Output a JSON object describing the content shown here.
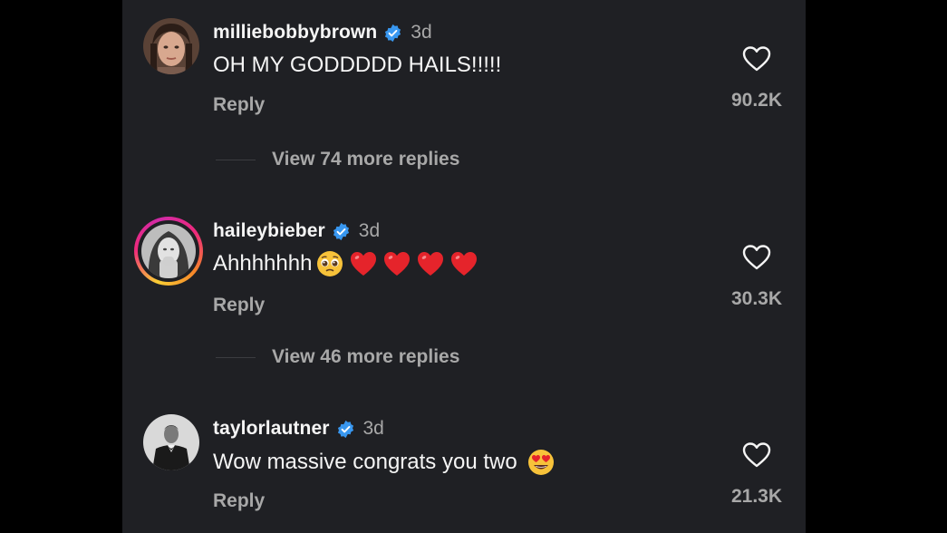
{
  "comments": [
    {
      "username": "milliebobbybrown",
      "time": "3d",
      "text": "OH MY GODDDDD HAILS!!!!!",
      "emojis": [],
      "reply_label": "Reply",
      "likes": "90.2K",
      "view_more": "View 74 more replies",
      "has_story": false
    },
    {
      "username": "haileybieber",
      "time": "3d",
      "text": "Ahhhhhhh",
      "emojis": [
        "pleading-face",
        "red-heart",
        "red-heart",
        "red-heart",
        "red-heart"
      ],
      "reply_label": "Reply",
      "likes": "30.3K",
      "view_more": "View 46 more replies",
      "has_story": true
    },
    {
      "username": "taylorlautner",
      "time": "3d",
      "text": "Wow massive congrats you two",
      "emojis": [
        "heart-eyes-face"
      ],
      "reply_label": "Reply",
      "likes": "21.3K",
      "view_more": null,
      "has_story": false
    }
  ],
  "colors": {
    "background": "#1f2024",
    "outer": "#000000",
    "text_primary": "#f5f5f5",
    "text_secondary": "#a8a8a8",
    "verified_blue": "#3897f0"
  }
}
